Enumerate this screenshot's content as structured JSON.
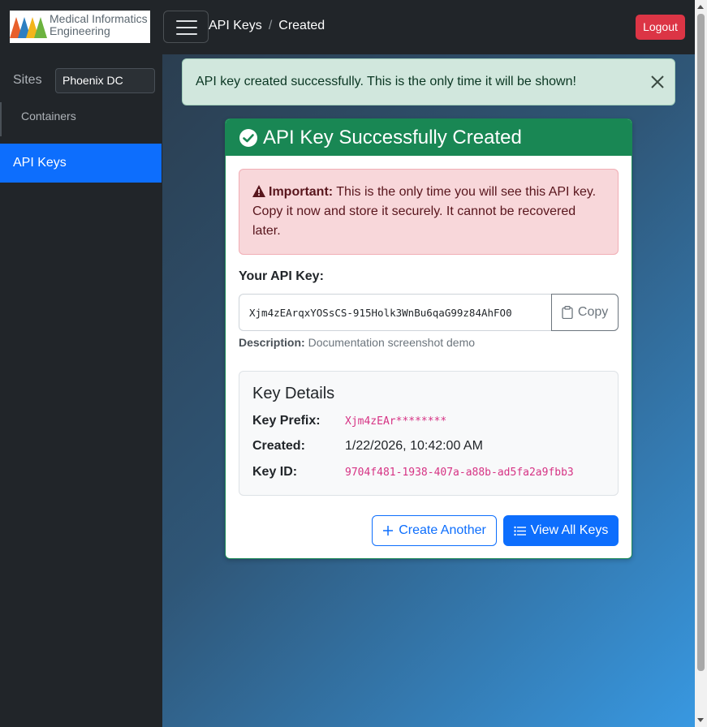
{
  "navbar": {
    "logo_text_line1": "Medical Informatics",
    "logo_text_line2": "Engineering",
    "breadcrumb": [
      "API Keys",
      "Created"
    ],
    "breadcrumb_sep": "/",
    "logout_label": "Logout"
  },
  "sidebar": {
    "sites_label": "Sites",
    "selected_site": "Phoenix DC",
    "items": [
      {
        "label": "Containers"
      },
      {
        "label": "API Keys",
        "active": true
      }
    ]
  },
  "alert": {
    "message": "API key created successfully. This is the only time it will be shown!"
  },
  "card": {
    "title": "API Key Successfully Created",
    "warning_strong": "Important:",
    "warning_text": "This is the only time you will see this API key. Copy it now and store it securely. It cannot be recovered later.",
    "key_label": "Your API Key:",
    "key_value": "Xjm4zEArqxYOSsCS-915Holk3WnBu6qaG99z84AhFO0",
    "copy_label": "Copy",
    "description_label": "Description:",
    "description_value": "Documentation screenshot demo",
    "details": {
      "title": "Key Details",
      "prefix_label": "Key Prefix:",
      "prefix_value": "Xjm4zEAr********",
      "created_label": "Created:",
      "created_value": "1/22/2026, 10:42:00 AM",
      "id_label": "Key ID:",
      "id_value": "9704f481-1938-407a-a88b-ad5fa2a9fbb3"
    },
    "create_another_label": "Create Another",
    "view_all_label": "View All Keys"
  },
  "colors": {
    "success": "#198754",
    "primary": "#0d6efd",
    "danger": "#dc3545",
    "dark": "#212529"
  }
}
